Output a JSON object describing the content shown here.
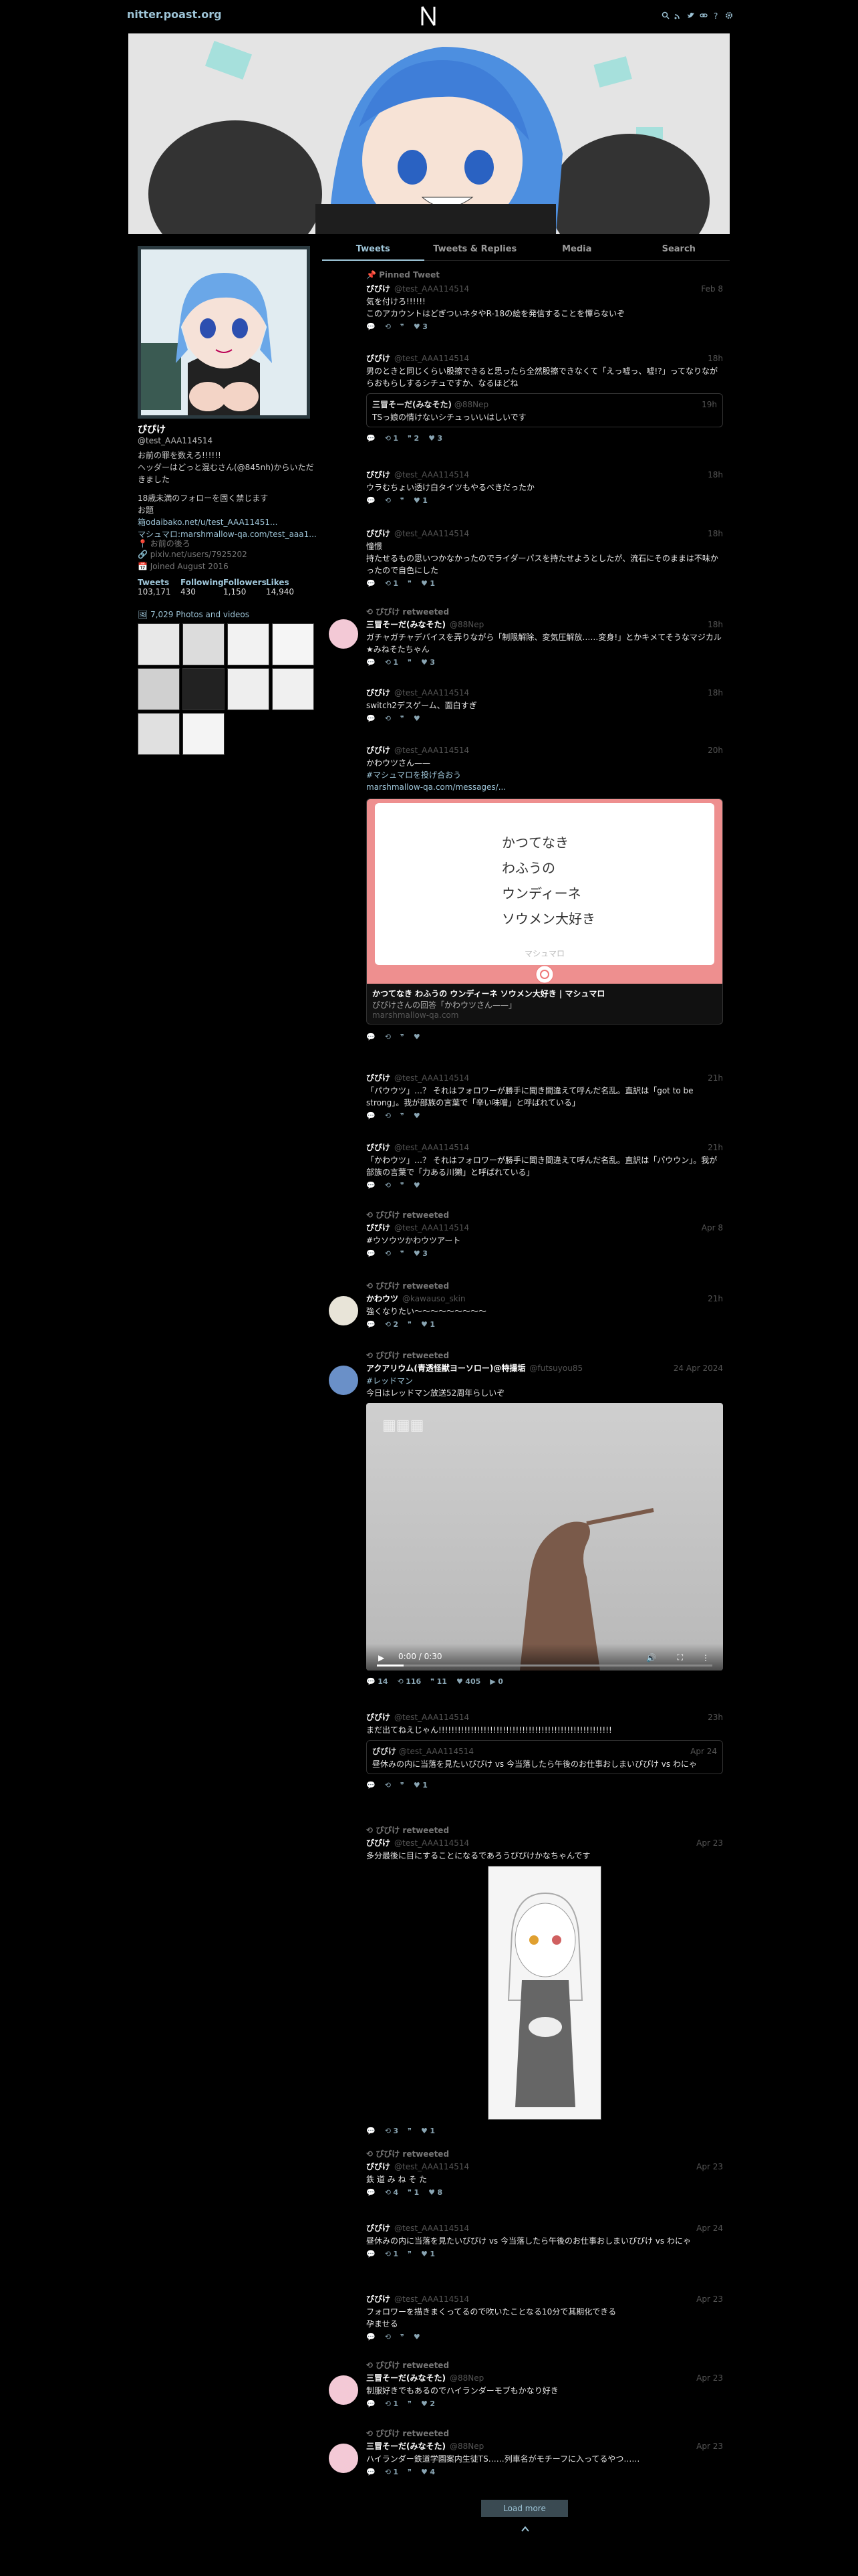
{
  "nav": {
    "brand": "nitter.poast.org"
  },
  "tabs": [
    "Tweets",
    "Tweets & Replies",
    "Media",
    "Search"
  ],
  "profile": {
    "fullname": "ぴぴけ",
    "username": "@test_AAA114514",
    "bio": [
      "お前の罪を数えろ!!!!!!",
      "ヘッダーはどっと混むさん(@845nh)からいただきました",
      "",
      "18歳未満のフォローを固く禁じます",
      "お題",
      "箱odaibako.net/u/test_AAA11451...",
      "マシュマロ:marshmallow-qa.com/test_aaa1..."
    ],
    "location": "お前の後ろ",
    "website": "pixiv.net/users/7925202",
    "joined": "Joined August 2016",
    "stats": [
      {
        "label": "Tweets",
        "value": "103,171"
      },
      {
        "label": "Following",
        "value": "430"
      },
      {
        "label": "Followers",
        "value": "1,150"
      },
      {
        "label": "Likes",
        "value": "14,940"
      }
    ],
    "photos_link": "7,029 Photos and videos"
  },
  "pinned_label": "Pinned Tweet",
  "retweeted_label": "ぴぴけ retweeted",
  "tweets": [
    {
      "name": "ぴぴけ",
      "handle": "@test_AAA114514",
      "date": "Feb 8",
      "text": [
        "気を付けろ!!!!!!",
        "このアカウントはどぎついネタやR-18の絵を発信することを憚らないぞ"
      ],
      "stats": [
        "",
        "",
        "",
        "3"
      ]
    },
    {
      "name": "ぴぴけ",
      "handle": "@test_AAA114514",
      "date": "18h",
      "text": [
        "男のときと同じくらい股擦できると思ったら全然股擦できなくて「えっ嘘っ、嘘!?」ってなりながらおもらしするシチュですか、なるほどね"
      ],
      "quote": {
        "name": "三冒そーだ(みなそた)",
        "handle": "@88Nep",
        "date": "19h",
        "text": "TSっ娘の情けないシチュっいいはしいです"
      },
      "stats": [
        "",
        "1",
        "2",
        "3"
      ]
    },
    {
      "name": "ぴぴけ",
      "handle": "@test_AAA114514",
      "date": "18h",
      "text": [
        "ウラむちょい透け白タイツもやるべきだったか"
      ],
      "stats": [
        "",
        "",
        "",
        "1"
      ]
    },
    {
      "name": "ぴぴけ",
      "handle": "@test_AAA114514",
      "date": "18h",
      "text": [
        "憧憬",
        "持たせるもの思いつかなかったのでライダーパスを持たせようとしたが、流石にそのままは不味かったので自色にした"
      ],
      "stats": [
        "",
        "1",
        "",
        "1"
      ]
    },
    {
      "name": "三冒そーだ(みなそた)",
      "handle": "@88Nep",
      "date": "18h",
      "text": [
        "ガチャガチャデバイスを弄りながら「制限解除、変気圧解放……変身!」とかキメてそうなマジカル★みねそたちゃん"
      ],
      "stats": [
        "",
        "1",
        "",
        "3"
      ]
    },
    {
      "name": "ぴぴけ",
      "handle": "@test_AAA114514",
      "date": "18h",
      "text": [
        "switch2デスゲーム、面白すぎ"
      ],
      "stats": [
        "",
        "",
        "",
        ""
      ]
    },
    {
      "name": "ぴぴけ",
      "handle": "@test_AAA114514",
      "date": "20h",
      "text": [
        "かわウツさん——",
        "#マシュマロを投げ合おう",
        "marshmallow-qa.com/messages/..."
      ],
      "card": {
        "lines": [
          "かつてなき",
          "わふうの",
          "ウンディーネ",
          "ソウメン大好き"
        ],
        "sub": "マシュマロ",
        "title": "かつてなき わふうの ウンディーネ ソウメン大好き | マシュマロ",
        "desc": "ぴぴけさんの回答「かわウツさん——」",
        "url": "marshmallow-qa.com"
      },
      "stats": [
        "",
        "",
        "",
        ""
      ]
    },
    {
      "name": "ぴぴけ",
      "handle": "@test_AAA114514",
      "date": "21h",
      "text": [
        "「パウウツ」…？ それはフォロワーが勝手に聞き間違えて呼んだ名乱。直訳は「got to be strong」。我が部族の言葉で「辛い味噌」と呼ばれている」"
      ],
      "stats": [
        "",
        "",
        "",
        ""
      ]
    },
    {
      "name": "ぴぴけ",
      "handle": "@test_AAA114514",
      "date": "21h",
      "text": [
        "「かわウツ」…？ それはフォロワーが勝手に聞き間違えて呼んだ名乱。直訳は「パウウン」。我が部族の言葉で「力ある川獺」と呼ばれている」"
      ],
      "stats": [
        "",
        "",
        "",
        ""
      ]
    },
    {
      "name": "ぴぴけ",
      "handle": "@test_AAA114514",
      "date": "Apr 8",
      "text": [
        "#ウソウツかわウツアート"
      ],
      "stats": [
        "",
        "",
        "",
        "3"
      ]
    },
    {
      "name": "かわウツ",
      "handle": "@kawauso_skin",
      "date": "21h",
      "text": [
        "強くなりたい〜〜〜〜〜〜〜〜〜"
      ],
      "stats": [
        "",
        "2",
        "",
        "1"
      ]
    },
    {
      "name": "アクアリウム(青透怪獣ヨーソロー)@特撮垢",
      "handle": "@futsuyou85",
      "date": "24 Apr 2024",
      "text": [
        "#レッドマン",
        "今日はレッドマン放送52周年らしいぞ"
      ],
      "video": {
        "time": "0:00 / 0:30"
      },
      "stats": [
        "14",
        "116",
        "11",
        "405",
        "0"
      ]
    },
    {
      "name": "ぴぴけ",
      "handle": "@test_AAA114514",
      "date": "23h",
      "text": [
        "まだ出てねえじゃん!!!!!!!!!!!!!!!!!!!!!!!!!!!!!!!!!!!!!!!!!!!!!!!!!!!!!!"
      ],
      "quote": {
        "name": "ぴぴけ",
        "handle": "@test_AAA114514",
        "date": "Apr 24",
        "text": "昼休みの内に当落を見たいぴぴけ vs 今当落したら午後のお仕事おしまいぴぴけ vs わにゃ"
      },
      "stats": [
        "",
        "",
        "",
        "1"
      ]
    },
    {
      "name": "ぴぴけ",
      "handle": "@test_AAA114514",
      "date": "Apr 23",
      "text": [
        "多分最後に目にすることになるであろうぴぴけかなちゃんです"
      ],
      "stats": [
        "",
        "3",
        "",
        "1"
      ]
    },
    {
      "name": "ぴぴけ",
      "handle": "@test_AAA114514",
      "date": "Apr 23",
      "text": [
        "鉄 道 み ね そ た"
      ],
      "stats": [
        "",
        "4",
        "1",
        "8"
      ]
    },
    {
      "name": "ぴぴけ",
      "handle": "@test_AAA114514",
      "date": "Apr 24",
      "text": [
        "昼休みの内に当落を見たいぴぴけ vs 今当落したら午後のお仕事おしまいぴぴけ vs わにゃ"
      ],
      "stats": [
        "",
        "1",
        "",
        "1"
      ]
    },
    {
      "name": "ぴぴけ",
      "handle": "@test_AAA114514",
      "date": "Apr 23",
      "text": [
        "フォロワーを描きまくってるので吹いたことなる10分で其期化できる",
        "孕ませる"
      ],
      "stats": [
        "",
        "",
        "",
        ""
      ]
    },
    {
      "name": "三冒そーだ(みなそた)",
      "handle": "@88Nep",
      "date": "Apr 23",
      "text": [
        "制服好きでもあるのでハイランダーモブもかなり好き"
      ],
      "stats": [
        "",
        "1",
        "",
        "2"
      ]
    },
    {
      "name": "三冒そーだ(みなそた)",
      "handle": "@88Nep",
      "date": "Apr 23",
      "text": [
        "ハイランダー鉄道学園案内生徒TS……列車名がモチーフに入ってるやつ……"
      ],
      "stats": [
        "",
        "1",
        "",
        "4"
      ]
    }
  ],
  "load_more": "Load more"
}
